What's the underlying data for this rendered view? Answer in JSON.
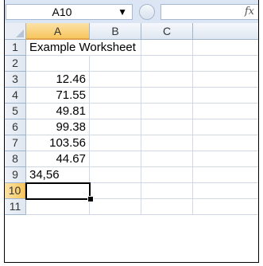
{
  "name_box": {
    "value": "A10",
    "dropdown_icon": "triangle-down-icon"
  },
  "formula_bar": {
    "function_icon": "fx-icon",
    "fx_label": "fx",
    "value": ""
  },
  "columns": [
    "A",
    "B",
    "C"
  ],
  "selected_cell": "A10",
  "rows": [
    {
      "num": "1",
      "A": "Example Worksheet",
      "align": "left"
    },
    {
      "num": "2",
      "A": "",
      "align": "left"
    },
    {
      "num": "3",
      "A": "12.46",
      "align": "right"
    },
    {
      "num": "4",
      "A": "71.55",
      "align": "right"
    },
    {
      "num": "5",
      "A": "49.81",
      "align": "right"
    },
    {
      "num": "6",
      "A": "99.38",
      "align": "right"
    },
    {
      "num": "7",
      "A": "103.56",
      "align": "right"
    },
    {
      "num": "8",
      "A": "44.67",
      "align": "right"
    },
    {
      "num": "9",
      "A": "34,56",
      "align": "left"
    },
    {
      "num": "10",
      "A": "",
      "align": "left"
    },
    {
      "num": "11",
      "A": "",
      "align": "left"
    }
  ]
}
